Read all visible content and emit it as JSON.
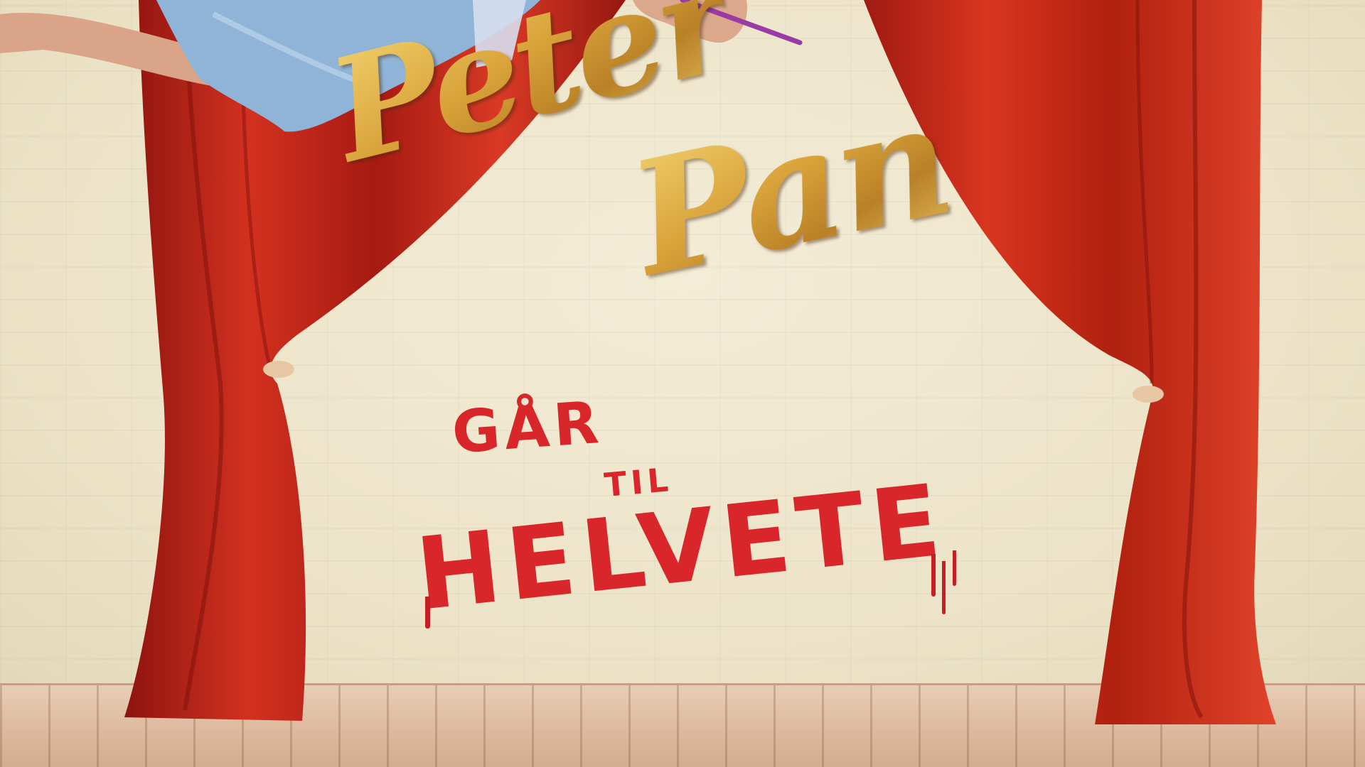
{
  "poster": {
    "title_word_1": "Peter",
    "title_word_2": "Pan",
    "subtitle_1": "GÅR",
    "subtitle_2": "TIL",
    "subtitle_3": "HELVETE"
  },
  "colors": {
    "curtain": "#c8281c",
    "gold": "#d9a93a",
    "red_text": "#d8262a",
    "wall": "#efe7cf",
    "floor": "#dcb89d"
  }
}
